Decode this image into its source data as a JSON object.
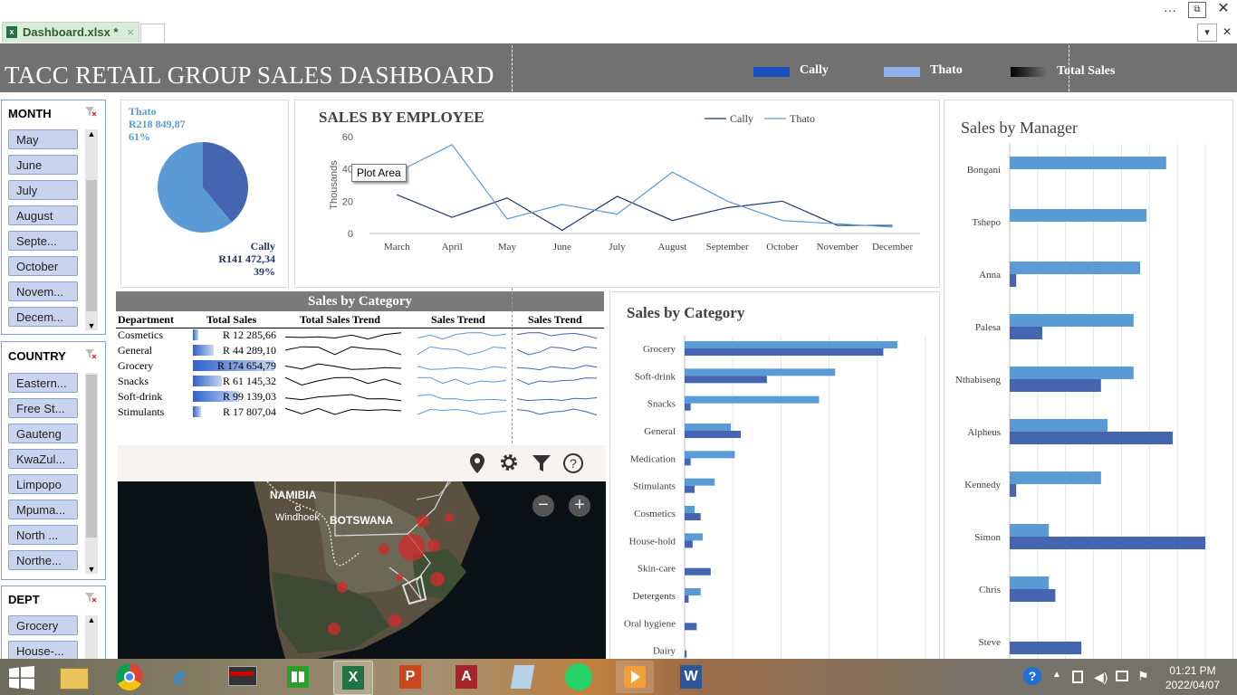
{
  "window": {
    "tab_label": "Dashboard.xlsx *",
    "tab_close": "×",
    "more": "···",
    "restore": "⧉",
    "close": "✕",
    "chevron": "▾",
    "close_small": "✕"
  },
  "dashboard": {
    "title": "TACC RETAIL GROUP SALES DASHBOARD",
    "legend": [
      {
        "label": "Cally",
        "color": "#1a4fbf"
      },
      {
        "label": "Thato",
        "color": "#8db0ea"
      },
      {
        "label": "Total Sales",
        "color": "#000000"
      }
    ]
  },
  "slicers": {
    "month": {
      "header": "MONTH",
      "items": [
        "May",
        "June",
        "July",
        "August",
        "Septe...",
        "October",
        "Novem...",
        "Decem..."
      ]
    },
    "country": {
      "header": "COUNTRY",
      "items": [
        "Eastern...",
        "Free St...",
        "Gauteng",
        "KwaZul...",
        "Limpopo",
        "Mpuma...",
        "North ...",
        "Northe..."
      ]
    },
    "dept": {
      "header": "DEPT",
      "items": [
        "Grocery",
        "House-..."
      ]
    }
  },
  "pie": {
    "thato_name": "Thato",
    "thato_value": "R218 849,87",
    "thato_pct": "61%",
    "cally_name": "Cally",
    "cally_value": "R141 472,34",
    "cally_pct": "39%",
    "thato_color": "#5b9bd5",
    "cally_color": "#4565b0"
  },
  "line_chart": {
    "tooltip": "Plot Area"
  },
  "category_table": {
    "title": "Sales by Category",
    "headers": [
      "Department",
      "Total Sales",
      "Total Sales Trend",
      "Sales Trend",
      "Sales Trend"
    ],
    "rows": [
      {
        "dept": "Cosmetics",
        "sales": "R 12 285,66",
        "frac": 0.07
      },
      {
        "dept": "General",
        "sales": "R 44 289,10",
        "frac": 0.25
      },
      {
        "dept": "Grocery",
        "sales": "R 174 654,79",
        "frac": 1.0
      },
      {
        "dept": "Snacks",
        "sales": "R 61 145,32",
        "frac": 0.35
      },
      {
        "dept": "Soft-drink",
        "sales": "R 99 139,03",
        "frac": 0.57
      },
      {
        "dept": "Stimulants",
        "sales": "R 17 807,04",
        "frac": 0.1
      }
    ]
  },
  "map": {
    "labels": {
      "namibia": "NAMIBIA",
      "windhoek": "Windhoek",
      "botswana": "BOTSWANA"
    },
    "zoom_out": "−",
    "zoom_in": "+"
  },
  "chart_data": [
    {
      "type": "line",
      "title": "SALES BY EMPLOYEE",
      "ylabel": "Thousands",
      "ylim": [
        0,
        60
      ],
      "yticks": [
        0,
        20,
        40,
        60
      ],
      "categories": [
        "March",
        "April",
        "May",
        "June",
        "July",
        "August",
        "September",
        "October",
        "November",
        "December"
      ],
      "series": [
        {
          "name": "Cally",
          "color": "#1f3864",
          "values": [
            24,
            10,
            22,
            2,
            23,
            8,
            16,
            20,
            5,
            5
          ]
        },
        {
          "name": "Thato",
          "color": "#5b9bd5",
          "values": [
            38,
            55,
            9,
            18,
            12,
            38,
            20,
            8,
            6,
            4
          ]
        }
      ]
    },
    {
      "type": "bar",
      "title": "Sales by Category",
      "categories": [
        "Grocery",
        "Soft-drink",
        "Snacks",
        "General",
        "Medication",
        "Stimulants",
        "Cosmetics",
        "House-hold",
        "Skin-care",
        "Detergents",
        "Oral hygiene",
        "Dairy"
      ],
      "series": [
        {
          "name": "Thato",
          "color": "#5b9bd5",
          "values": [
            106,
            75,
            67,
            23,
            25,
            15,
            5,
            9,
            0,
            8,
            0,
            0
          ]
        },
        {
          "name": "Cally",
          "color": "#4565b0",
          "values": [
            99,
            41,
            3,
            28,
            3,
            5,
            8,
            4,
            13,
            2,
            6,
            1
          ]
        }
      ]
    },
    {
      "type": "bar",
      "title": "Sales by Manager",
      "categories": [
        "Bongani",
        "Tshepo",
        "Anna",
        "Palesa",
        "Nthabiseng",
        "Alpheus",
        "Kennedy",
        "Simon",
        "Chris",
        "Steve"
      ],
      "series": [
        {
          "name": "Thato",
          "color": "#5b9bd5",
          "values": [
            24,
            21,
            20,
            19,
            19,
            15,
            14,
            6,
            6,
            0
          ]
        },
        {
          "name": "Cally",
          "color": "#4565b0",
          "values": [
            0,
            0,
            1,
            5,
            14,
            25,
            1,
            30,
            7,
            11
          ]
        }
      ]
    }
  ],
  "taskbar": {
    "time": "01:21 PM",
    "date": "2022/04/07"
  }
}
